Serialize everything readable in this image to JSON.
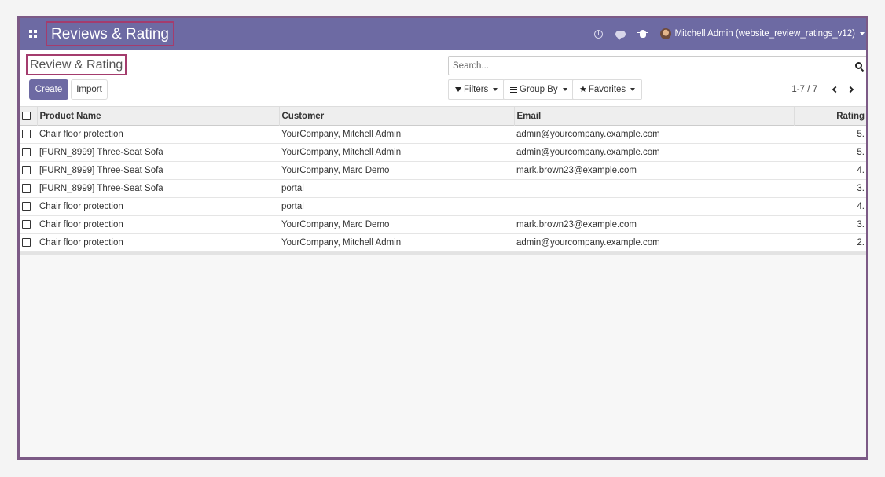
{
  "navbar": {
    "app_title": "Reviews & Rating",
    "user_name": "Mitchell Admin (website_review_ratings_v12)"
  },
  "control_panel": {
    "breadcrumb": "Review & Rating",
    "create_label": "Create",
    "import_label": "Import",
    "search_placeholder": "Search...",
    "filters_label": "Filters",
    "group_by_label": "Group By",
    "favorites_label": "Favorites",
    "pager_value": "1-7 / 7"
  },
  "table": {
    "columns": [
      "Product Name",
      "Customer",
      "Email",
      "Rating"
    ],
    "rows": [
      {
        "product": "Chair floor protection",
        "customer": "YourCompany, Mitchell Admin",
        "email": "admin@yourcompany.example.com",
        "rating": "5."
      },
      {
        "product": "[FURN_8999] Three-Seat Sofa",
        "customer": "YourCompany, Mitchell Admin",
        "email": "admin@yourcompany.example.com",
        "rating": "5."
      },
      {
        "product": "[FURN_8999] Three-Seat Sofa",
        "customer": "YourCompany, Marc Demo",
        "email": "mark.brown23@example.com",
        "rating": "4."
      },
      {
        "product": "[FURN_8999] Three-Seat Sofa",
        "customer": "portal",
        "email": "",
        "rating": "3."
      },
      {
        "product": "Chair floor protection",
        "customer": "portal",
        "email": "",
        "rating": "4."
      },
      {
        "product": "Chair floor protection",
        "customer": "YourCompany, Marc Demo",
        "email": "mark.brown23@example.com",
        "rating": "3."
      },
      {
        "product": "Chair floor protection",
        "customer": "YourCompany, Mitchell Admin",
        "email": "admin@yourcompany.example.com",
        "rating": "2."
      }
    ]
  },
  "colors": {
    "navbar": "#6d6aa3",
    "highlight_border": "#a43c6d",
    "frame_border": "#7c5a86"
  }
}
